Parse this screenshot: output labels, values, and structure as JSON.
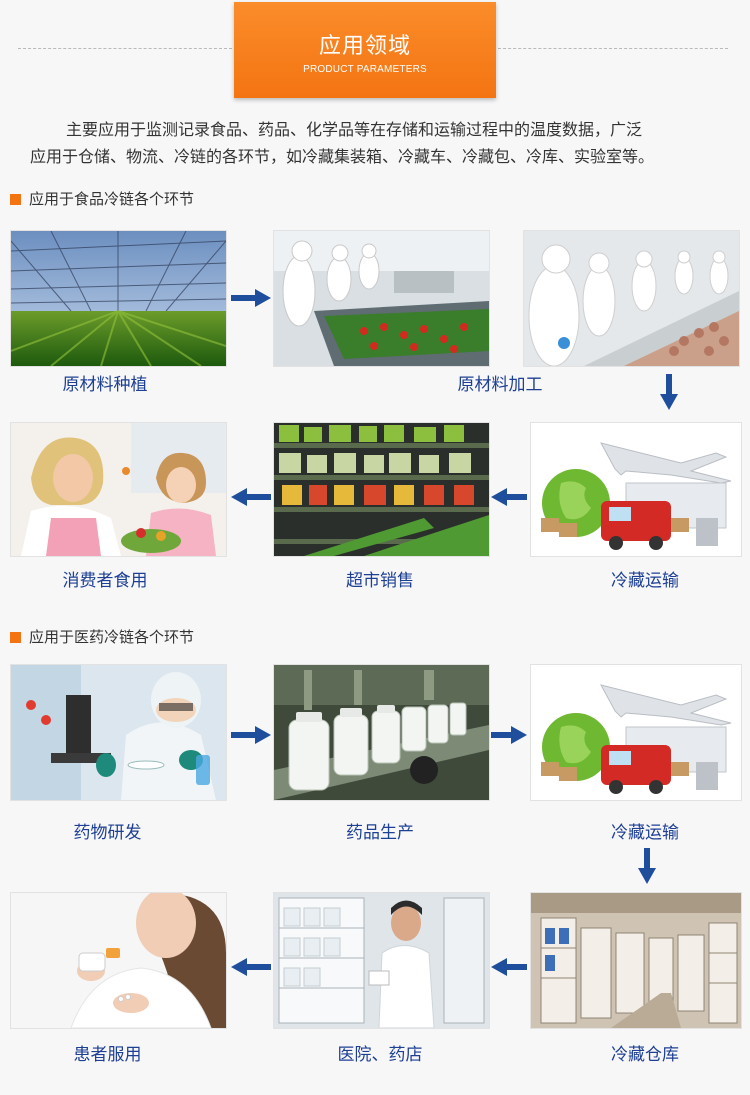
{
  "header": {
    "title": "应用领域",
    "subtitle": "PRODUCT PARAMETERS"
  },
  "intro": {
    "line1": "主要应用于监测记录食品、药品、化学品等在存储和运输过程中的温度数据，广泛",
    "line2": "应用于仓储、物流、冷链的各环节，如冷藏集装箱、冷藏车、冷藏包、冷库、实验室等。"
  },
  "food_section": {
    "heading": "应用于食品冷链各个环节",
    "steps": {
      "planting": "原材料种植",
      "processing": "原材料加工",
      "consumer": "消费者食用",
      "supermarket": "超市销售",
      "transport": "冷藏运输"
    }
  },
  "pharma_section": {
    "heading": "应用于医药冷链各个环节",
    "steps": {
      "research": "药物研发",
      "production": "药品生产",
      "transport": "冷藏运输",
      "patient": "患者服用",
      "hospital": "医院、药店",
      "warehouse": "冷藏仓库"
    }
  },
  "colors": {
    "accent": "#f47412",
    "label": "#1d3f94",
    "arrow": "#1f4f9c"
  }
}
